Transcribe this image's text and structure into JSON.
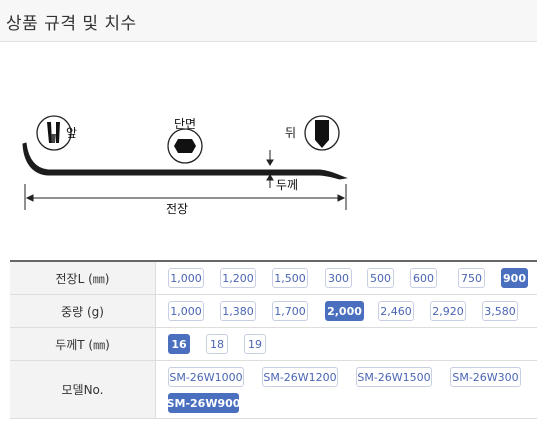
{
  "header": {
    "title": "상품 규격 및 치수"
  },
  "diagram": {
    "front_label": "앞",
    "section_label": "단면",
    "back_label": "뒤",
    "thickness_label": "두께",
    "length_label": "전장"
  },
  "specs": [
    {
      "label": "전장L (㎜)",
      "options": [
        "1,000",
        "1,200",
        "1,500",
        "300",
        "500",
        "600",
        "750",
        "900"
      ],
      "selected": "900"
    },
    {
      "label": "중량 (g)",
      "options": [
        "1,000",
        "1,380",
        "1,700",
        "2,000",
        "2,460",
        "2,920",
        "3,580"
      ],
      "selected": "2,000"
    },
    {
      "label": "두께T (㎜)",
      "options": [
        "16",
        "18",
        "19"
      ],
      "selected": "16"
    },
    {
      "label": "모델No.",
      "options": [
        "SM-26W1000",
        "SM-26W1200",
        "SM-26W1500",
        "SM-26W300",
        "SM-26W900"
      ],
      "selected": "SM-26W900"
    }
  ]
}
